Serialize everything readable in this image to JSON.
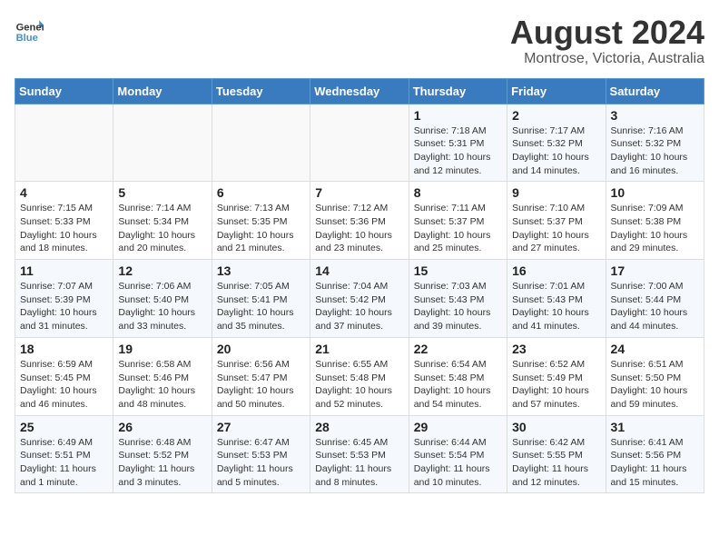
{
  "header": {
    "logo_line1": "General",
    "logo_line2": "Blue",
    "month_year": "August 2024",
    "location": "Montrose, Victoria, Australia"
  },
  "weekdays": [
    "Sunday",
    "Monday",
    "Tuesday",
    "Wednesday",
    "Thursday",
    "Friday",
    "Saturday"
  ],
  "weeks": [
    [
      {
        "day": "",
        "info": ""
      },
      {
        "day": "",
        "info": ""
      },
      {
        "day": "",
        "info": ""
      },
      {
        "day": "",
        "info": ""
      },
      {
        "day": "1",
        "info": "Sunrise: 7:18 AM\nSunset: 5:31 PM\nDaylight: 10 hours\nand 12 minutes."
      },
      {
        "day": "2",
        "info": "Sunrise: 7:17 AM\nSunset: 5:32 PM\nDaylight: 10 hours\nand 14 minutes."
      },
      {
        "day": "3",
        "info": "Sunrise: 7:16 AM\nSunset: 5:32 PM\nDaylight: 10 hours\nand 16 minutes."
      }
    ],
    [
      {
        "day": "4",
        "info": "Sunrise: 7:15 AM\nSunset: 5:33 PM\nDaylight: 10 hours\nand 18 minutes."
      },
      {
        "day": "5",
        "info": "Sunrise: 7:14 AM\nSunset: 5:34 PM\nDaylight: 10 hours\nand 20 minutes."
      },
      {
        "day": "6",
        "info": "Sunrise: 7:13 AM\nSunset: 5:35 PM\nDaylight: 10 hours\nand 21 minutes."
      },
      {
        "day": "7",
        "info": "Sunrise: 7:12 AM\nSunset: 5:36 PM\nDaylight: 10 hours\nand 23 minutes."
      },
      {
        "day": "8",
        "info": "Sunrise: 7:11 AM\nSunset: 5:37 PM\nDaylight: 10 hours\nand 25 minutes."
      },
      {
        "day": "9",
        "info": "Sunrise: 7:10 AM\nSunset: 5:37 PM\nDaylight: 10 hours\nand 27 minutes."
      },
      {
        "day": "10",
        "info": "Sunrise: 7:09 AM\nSunset: 5:38 PM\nDaylight: 10 hours\nand 29 minutes."
      }
    ],
    [
      {
        "day": "11",
        "info": "Sunrise: 7:07 AM\nSunset: 5:39 PM\nDaylight: 10 hours\nand 31 minutes."
      },
      {
        "day": "12",
        "info": "Sunrise: 7:06 AM\nSunset: 5:40 PM\nDaylight: 10 hours\nand 33 minutes."
      },
      {
        "day": "13",
        "info": "Sunrise: 7:05 AM\nSunset: 5:41 PM\nDaylight: 10 hours\nand 35 minutes."
      },
      {
        "day": "14",
        "info": "Sunrise: 7:04 AM\nSunset: 5:42 PM\nDaylight: 10 hours\nand 37 minutes."
      },
      {
        "day": "15",
        "info": "Sunrise: 7:03 AM\nSunset: 5:43 PM\nDaylight: 10 hours\nand 39 minutes."
      },
      {
        "day": "16",
        "info": "Sunrise: 7:01 AM\nSunset: 5:43 PM\nDaylight: 10 hours\nand 41 minutes."
      },
      {
        "day": "17",
        "info": "Sunrise: 7:00 AM\nSunset: 5:44 PM\nDaylight: 10 hours\nand 44 minutes."
      }
    ],
    [
      {
        "day": "18",
        "info": "Sunrise: 6:59 AM\nSunset: 5:45 PM\nDaylight: 10 hours\nand 46 minutes."
      },
      {
        "day": "19",
        "info": "Sunrise: 6:58 AM\nSunset: 5:46 PM\nDaylight: 10 hours\nand 48 minutes."
      },
      {
        "day": "20",
        "info": "Sunrise: 6:56 AM\nSunset: 5:47 PM\nDaylight: 10 hours\nand 50 minutes."
      },
      {
        "day": "21",
        "info": "Sunrise: 6:55 AM\nSunset: 5:48 PM\nDaylight: 10 hours\nand 52 minutes."
      },
      {
        "day": "22",
        "info": "Sunrise: 6:54 AM\nSunset: 5:48 PM\nDaylight: 10 hours\nand 54 minutes."
      },
      {
        "day": "23",
        "info": "Sunrise: 6:52 AM\nSunset: 5:49 PM\nDaylight: 10 hours\nand 57 minutes."
      },
      {
        "day": "24",
        "info": "Sunrise: 6:51 AM\nSunset: 5:50 PM\nDaylight: 10 hours\nand 59 minutes."
      }
    ],
    [
      {
        "day": "25",
        "info": "Sunrise: 6:49 AM\nSunset: 5:51 PM\nDaylight: 11 hours\nand 1 minute."
      },
      {
        "day": "26",
        "info": "Sunrise: 6:48 AM\nSunset: 5:52 PM\nDaylight: 11 hours\nand 3 minutes."
      },
      {
        "day": "27",
        "info": "Sunrise: 6:47 AM\nSunset: 5:53 PM\nDaylight: 11 hours\nand 5 minutes."
      },
      {
        "day": "28",
        "info": "Sunrise: 6:45 AM\nSunset: 5:53 PM\nDaylight: 11 hours\nand 8 minutes."
      },
      {
        "day": "29",
        "info": "Sunrise: 6:44 AM\nSunset: 5:54 PM\nDaylight: 11 hours\nand 10 minutes."
      },
      {
        "day": "30",
        "info": "Sunrise: 6:42 AM\nSunset: 5:55 PM\nDaylight: 11 hours\nand 12 minutes."
      },
      {
        "day": "31",
        "info": "Sunrise: 6:41 AM\nSunset: 5:56 PM\nDaylight: 11 hours\nand 15 minutes."
      }
    ]
  ]
}
